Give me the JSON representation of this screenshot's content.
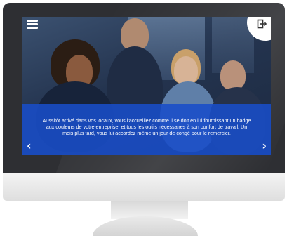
{
  "slide": {
    "caption": "Aussitôt arrivé dans vos locaux, vous l'accueillez comme il se doit en lui fournissant un badge aux couleurs de votre entreprise, et tous les outils nécessaires à son confort de travail. Un mois plus tard, vous lui accordez même un jour de congé pour le remercier.",
    "accent_color": "#1e50c8"
  },
  "icons": {
    "menu": "hamburger-menu-icon",
    "exit": "exit-icon",
    "prev": "chevron-left-icon",
    "next": "chevron-right-icon"
  }
}
